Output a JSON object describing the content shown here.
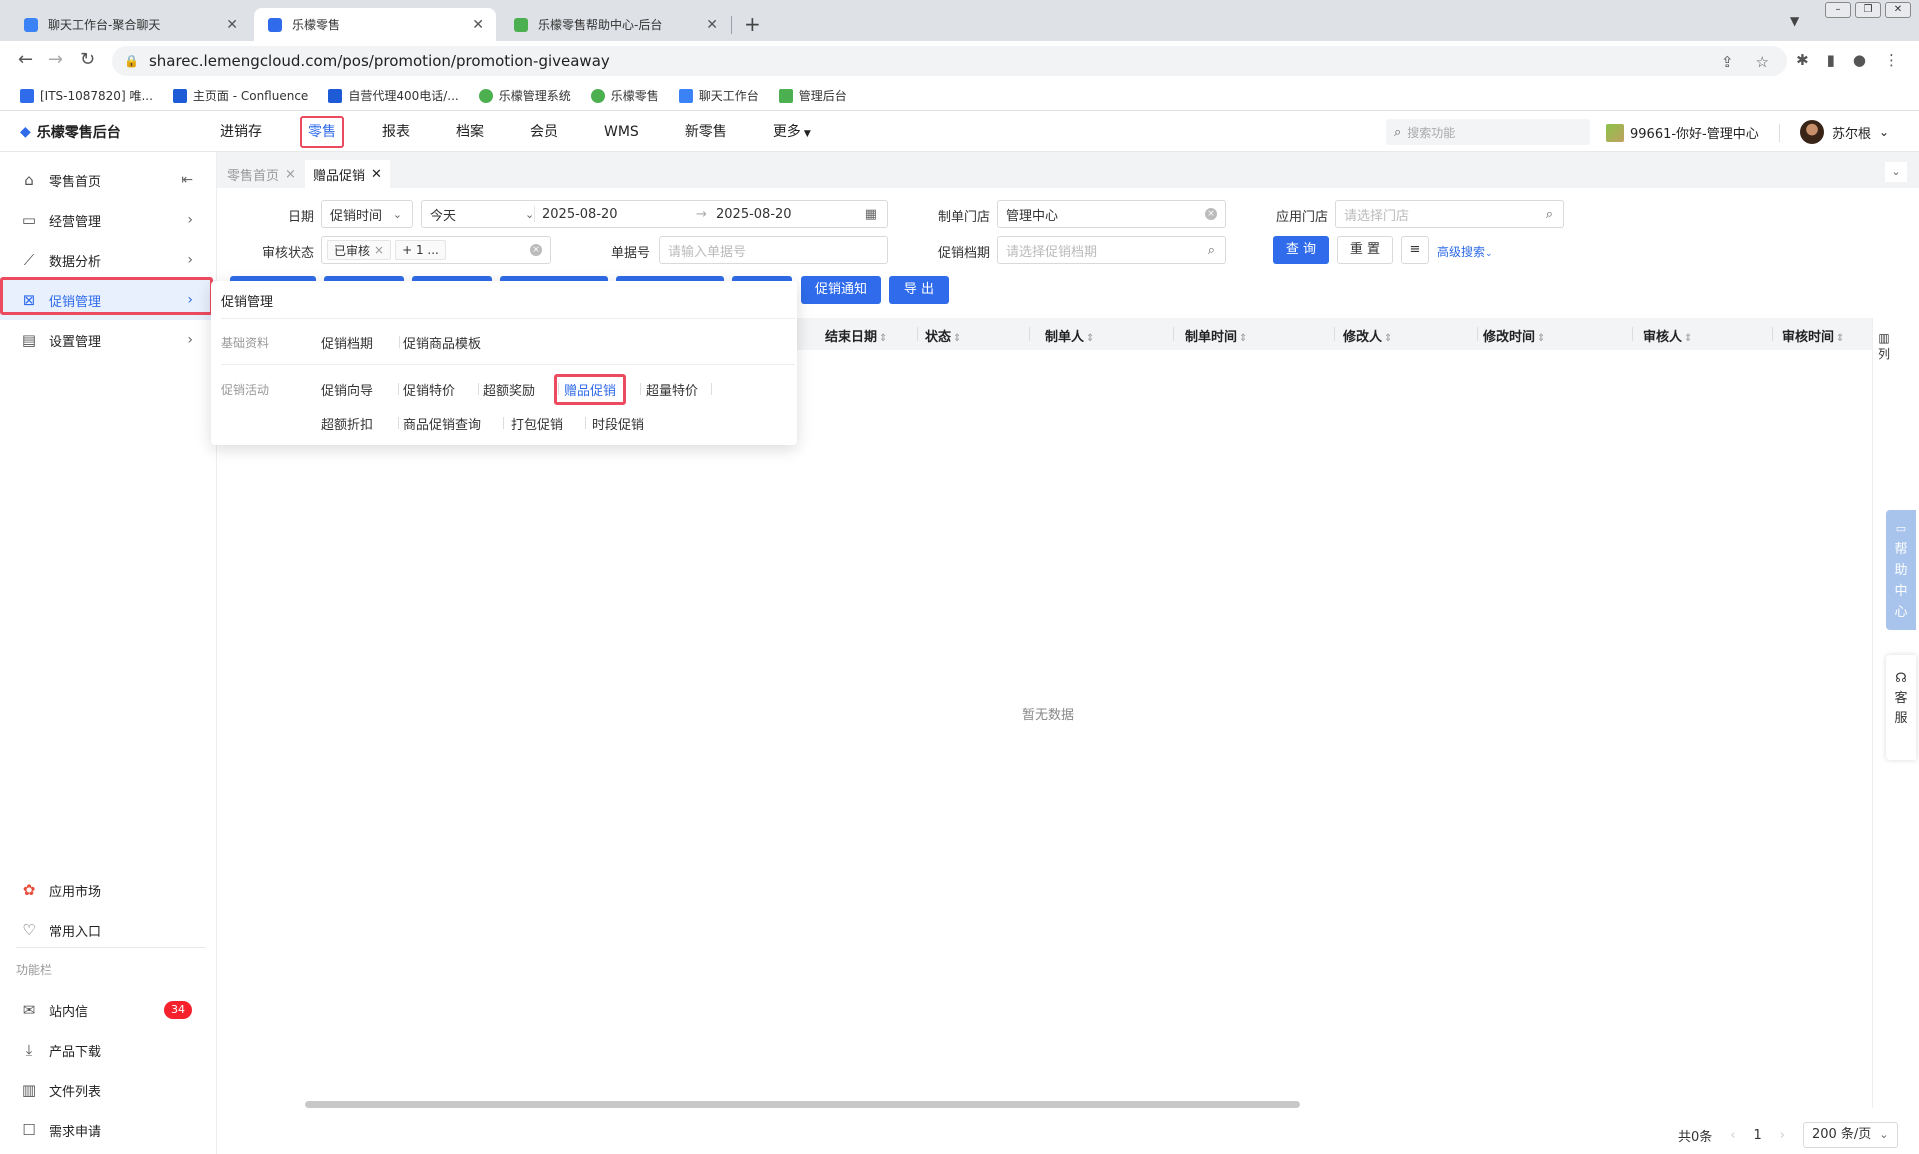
{
  "browser": {
    "tabs": [
      {
        "title": "聊天工作台-聚合聊天",
        "color": "#3b82f6"
      },
      {
        "title": "乐檬零售",
        "color": "#2f6bea"
      },
      {
        "title": "乐檬零售帮助中心-后台",
        "color": "#4caf50"
      }
    ],
    "url": "sharec.lemengcloud.com/pos/promotion/promotion-giveaway",
    "bookmarks": [
      {
        "label": "[ITS-1087820] 唯...",
        "color": "#2f6bea"
      },
      {
        "label": "主页面 - Confluence",
        "color": "#1e5bd6"
      },
      {
        "label": "自营代理400电话/...",
        "color": "#1e5bd6"
      },
      {
        "label": "乐檬管理系统",
        "color": "#4caf50"
      },
      {
        "label": "乐檬零售",
        "color": "#4caf50"
      },
      {
        "label": "聊天工作台",
        "color": "#3b82f6"
      },
      {
        "label": "管理后台",
        "color": "#4caf50"
      }
    ]
  },
  "header": {
    "logo": "乐檬零售后台",
    "nav": [
      "进销存",
      "零售",
      "报表",
      "档案",
      "会员",
      "WMS",
      "新零售",
      "更多"
    ],
    "active_nav": "零售",
    "search_placeholder": "搜索功能",
    "store": "99661-你好-管理中心",
    "user": "苏尔根"
  },
  "sidebar": {
    "items": [
      "零售首页",
      "经营管理",
      "数据分析",
      "促销管理",
      "设置管理"
    ],
    "bottom_items": [
      "应用市场",
      "常用入口"
    ],
    "group_label": "功能栏",
    "func_items": [
      "站内信",
      "产品下载",
      "文件列表",
      "需求申请"
    ],
    "message_count": "34"
  },
  "page_tabs": [
    "零售首页",
    "赠品促销"
  ],
  "filters": {
    "date_label": "日期",
    "date_type": "促销时间",
    "date_range": "今天",
    "date_start": "2025-08-20",
    "date_end": "2025-08-20",
    "maker_store_label": "制单门店",
    "maker_store_value": "管理中心",
    "apply_store_label": "应用门店",
    "apply_store_placeholder": "请选择门店",
    "audit_label": "审核状态",
    "audit_tag1": "已审核",
    "audit_tag2": "+ 1 ...",
    "order_no_label": "单据号",
    "order_no_placeholder": "请输入单据号",
    "promo_file_label": "促销档期",
    "promo_file_placeholder": "请选择促销档期",
    "query_btn": "查 询",
    "reset_btn": "重 置",
    "advanced": "高级搜索"
  },
  "actions": {
    "notify": "促销通知",
    "export": "导 出"
  },
  "table": {
    "columns": [
      "结束日期",
      "状态",
      "制单人",
      "制单时间",
      "修改人",
      "修改时间",
      "审核人",
      "审核时间"
    ],
    "column_setting": "列",
    "empty": "暂无数据"
  },
  "pager": {
    "total": "共0条",
    "page": "1",
    "size": "200 条/页"
  },
  "dropdown": {
    "title": "促销管理",
    "basic_label": "基础资料",
    "basic_links": [
      "促销档期",
      "促销商品模板"
    ],
    "activity_label": "促销活动",
    "activity_row1": [
      "促销向导",
      "促销特价",
      "超额奖励",
      "赠品促销",
      "超量特价"
    ],
    "activity_row2": [
      "超额折扣",
      "商品促销查询",
      "打包促销",
      "时段促销"
    ]
  },
  "float": {
    "help": [
      "帮",
      "助",
      "中",
      "心"
    ],
    "service": [
      "客",
      "服"
    ]
  }
}
